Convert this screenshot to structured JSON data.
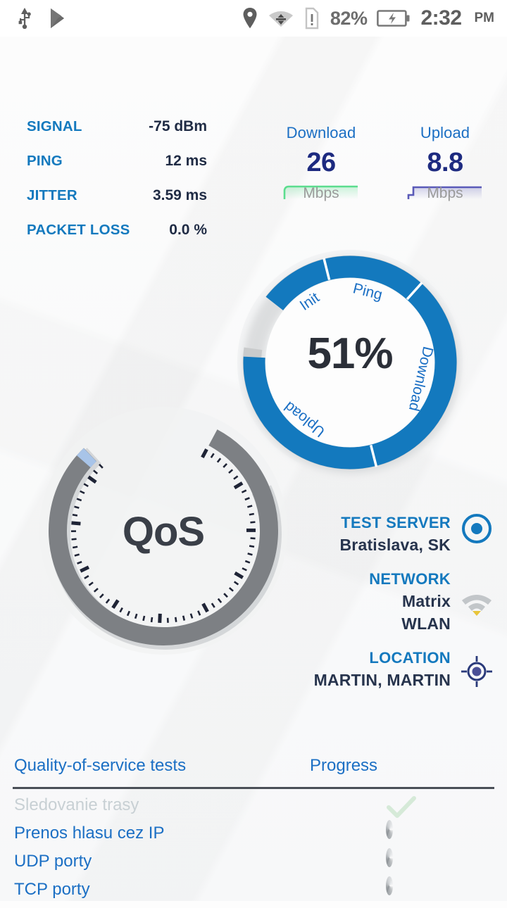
{
  "statusbar": {
    "icons_left": [
      "usb-icon",
      "play-store-icon"
    ],
    "icons_right": [
      "location-pin-icon",
      "wifi-transfer-icon",
      "sim-alert-icon"
    ],
    "battery_percent": "82%",
    "battery_icon": "battery-charging-icon",
    "time": "2:32",
    "ampm": "PM"
  },
  "stats": [
    {
      "label": "SIGNAL",
      "value": "-75 dBm"
    },
    {
      "label": "PING",
      "value": "12 ms"
    },
    {
      "label": "JITTER",
      "value": "3.59 ms"
    },
    {
      "label": "PACKET LOSS",
      "value": "0.0 %"
    }
  ],
  "download": {
    "title": "Download",
    "value": "26",
    "unit": "Mbps",
    "spark_color": "#5bdd8e"
  },
  "upload": {
    "title": "Upload",
    "value": "8.8",
    "unit": "Mbps",
    "spark_color": "#5a5ab8"
  },
  "progress_ring": {
    "percent_label": "51%",
    "percent": 51,
    "track_color": "#c9cbcc",
    "arc_color": "#1379be",
    "segments": [
      {
        "label": "Init",
        "start": 0,
        "end": 8
      },
      {
        "label": "Ping",
        "start": 8,
        "end": 22
      },
      {
        "label": "Download",
        "start": 22,
        "end": 52
      },
      {
        "label": "Upload",
        "start": 52,
        "end": 78
      }
    ]
  },
  "qos_gauge": {
    "center_label": "QoS",
    "arc_color": "#7d8084",
    "cap_color": "#a8c4e8",
    "tick_color": "#1f2436"
  },
  "info": {
    "test_server": {
      "label": "TEST SERVER",
      "value": "Bratislava, SK",
      "icon": "target-circle-icon",
      "icon_color": "#1479be"
    },
    "network": {
      "label": "NETWORK",
      "value_1": "Matrix",
      "value_2": "WLAN",
      "icon": "wifi-icon",
      "icon_color": "#c2c6c9",
      "icon_accent": "#e8c53a"
    },
    "location": {
      "label": "LOCATION",
      "value": "MARTIN, MARTIN",
      "icon": "crosshair-location-icon",
      "icon_color": "#2a3a7a"
    }
  },
  "tests_table": {
    "col_tests": "Quality-of-service tests",
    "col_progress": "Progress",
    "rows": [
      {
        "name": "Sledovanie trasy",
        "state": "done",
        "progress_icon": "check-icon"
      },
      {
        "name": "Prenos hlasu cez IP",
        "state": "running",
        "progress_icon": "spinner-icon"
      },
      {
        "name": "UDP porty",
        "state": "running",
        "progress_icon": "spinner-icon"
      },
      {
        "name": "TCP porty",
        "state": "running",
        "progress_icon": "spinner-icon"
      }
    ]
  },
  "colors": {
    "accent_blue": "#1479be",
    "dark_navy": "#1f2b44",
    "value_navy": "#1d2a80",
    "gray_track": "#c9cbcc"
  }
}
